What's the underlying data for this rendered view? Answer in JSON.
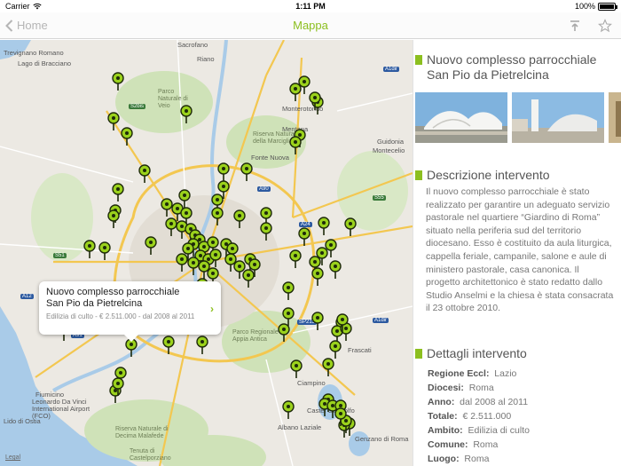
{
  "status": {
    "carrier": "Carrier",
    "time": "1:11 PM",
    "battery": "100%",
    "battery_level": 1.0
  },
  "nav": {
    "back_label": "Home",
    "title": "Mappa",
    "share_icon": "share-icon",
    "star_icon": "star-icon"
  },
  "map": {
    "legal": "Legal",
    "labels": [
      {
        "t": "Sacrofano",
        "c": "town"
      },
      {
        "t": "Riano",
        "c": "town"
      },
      {
        "t": "Monterotondo",
        "c": "town"
      },
      {
        "t": "Mentana",
        "c": "town"
      },
      {
        "t": "Fonte Nuova",
        "c": "town"
      },
      {
        "t": "Guidonia",
        "c": "town"
      },
      {
        "t": "Montecelio",
        "c": "town"
      },
      {
        "t": "Parco Naturale di Veio",
        "c": "park"
      },
      {
        "t": "Riserva Naturale della Marcigliana",
        "c": "park"
      },
      {
        "t": "Ciampino",
        "c": "town"
      },
      {
        "t": "Frascati",
        "c": "town"
      },
      {
        "t": "Fiumicino",
        "c": "town"
      },
      {
        "t": "Leonardo Da Vinci International Airport (FCO)",
        "c": "town"
      },
      {
        "t": "Parco Regionale Appia Antica",
        "c": "park"
      },
      {
        "t": "Castel Gandolfo",
        "c": "town"
      },
      {
        "t": "Albano Laziale",
        "c": "town"
      },
      {
        "t": "Genzano di Roma",
        "c": "town"
      },
      {
        "t": "Lido di Ostia",
        "c": "town"
      },
      {
        "t": "Riserva Naturale di Decima Malafede",
        "c": "park"
      },
      {
        "t": "Tenuta di Castelporziano",
        "c": "park"
      },
      {
        "t": "Trevignano Romano",
        "c": "town"
      },
      {
        "t": "Lago di Bracciano",
        "c": "town"
      }
    ],
    "callout": {
      "title": "Nuovo complesso parrocchiale San Pio da Pietrelcina",
      "subtitle": "Edilizia di culto - € 2.511.000 - dal 2008 al 2011"
    }
  },
  "panel": {
    "title": "Nuovo complesso parrocchiale San Pio da Pietrelcina",
    "description_heading": "Descrizione intervento",
    "description": "Il nuovo complesso parrocchiale è stato realizzato per garantire un adeguato servizio pastorale nel quartiere “Giardino di Roma” situato nella periferia sud del territorio diocesano. Esso è costituito da aula liturgica, cappella feriale, campanile, salone e aule di ministero pastorale, casa canonica. Il progetto architettonico è stato redatto dallo Studio Anselmi e la chiesa è stata consacrata il 23 ottobre 2010.",
    "details_heading": "Dettagli intervento",
    "details": [
      {
        "k": "Regione Eccl:",
        "v": "Lazio"
      },
      {
        "k": "Diocesi:",
        "v": "Roma"
      },
      {
        "k": "Anno:",
        "v": "dal 2008 al 2011"
      },
      {
        "k": "Totale:",
        "v": "€ 2.511.000"
      },
      {
        "k": "Ambito:",
        "v": "Edilizia di culto"
      },
      {
        "k": "Comune:",
        "v": "Roma"
      },
      {
        "k": "Luogo:",
        "v": "Roma"
      }
    ]
  },
  "colors": {
    "accent": "#8cbf1f",
    "pin": "#9bd21c",
    "pin_outline": "#1e2a0a"
  }
}
